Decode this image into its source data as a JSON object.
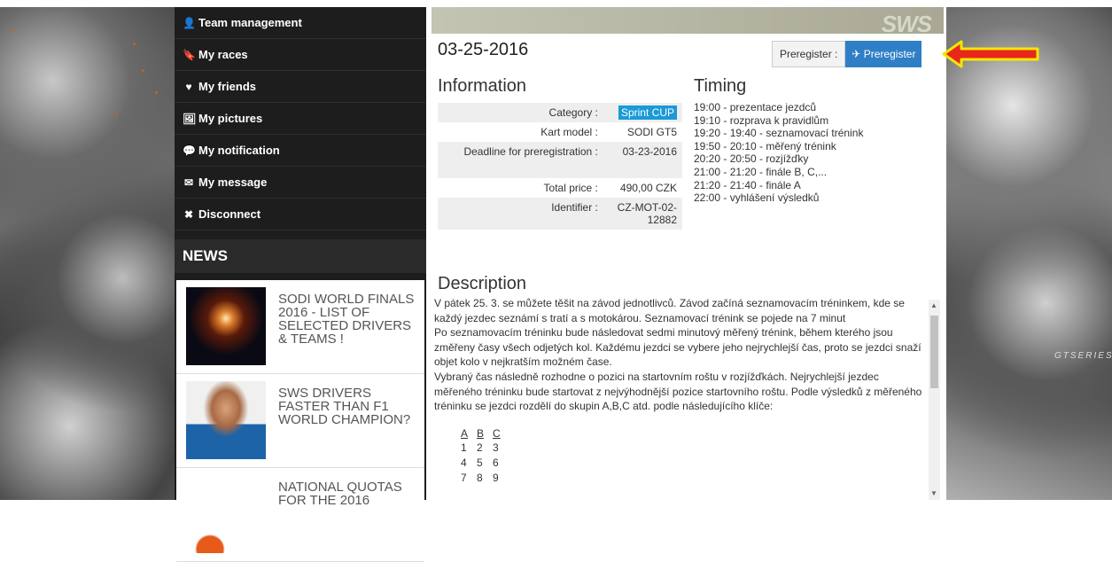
{
  "menu": [
    {
      "icon": "user-icon",
      "glyph": "👤",
      "label": "Team management"
    },
    {
      "icon": "bookmark-icon",
      "glyph": "🔖",
      "label": "My races"
    },
    {
      "icon": "heart-icon",
      "glyph": "♥",
      "label": "My friends"
    },
    {
      "icon": "picture-icon",
      "glyph": "🖼",
      "label": "My pictures"
    },
    {
      "icon": "comment-icon",
      "glyph": "💬",
      "label": "My notification"
    },
    {
      "icon": "envelope-icon",
      "glyph": "✉",
      "label": "My message"
    },
    {
      "icon": "close-icon",
      "glyph": "✖",
      "label": "Disconnect"
    }
  ],
  "news": {
    "title": "NEWS",
    "items": [
      {
        "title": "SODI WORLD FINALS 2016 - LIST OF SELECTED DRIVERS & TEAMS !"
      },
      {
        "title": "SWS DRIVERS FASTER THAN F1 WORLD CHAMPION?"
      },
      {
        "title": "NATIONAL QUOTAS FOR THE 2016"
      }
    ]
  },
  "race": {
    "date": "03-25-2016",
    "prereg_label": "Preregister :",
    "prereg_button": "Preregister",
    "info_title": "Information",
    "timing_title": "Timing",
    "info": [
      {
        "key": "Category :",
        "value": "Sprint CUP"
      },
      {
        "key": "Kart model :",
        "value": "SODI GT5"
      },
      {
        "key": "Deadline for preregistration :",
        "value": "03-23-2016"
      },
      {
        "key": "Total price :",
        "value": "490,00 CZK"
      },
      {
        "key": "Identifier :",
        "value": "CZ-MOT-02-12882"
      }
    ],
    "timing": [
      "19:00 - prezentace jezdců",
      "19:10 - rozprava k pravidlům",
      "19:20 - 19:40 - seznamovací trénink",
      "19:50 - 20:10 - měřený trénink",
      "20:20 - 20:50 - rozjížďky",
      "21:00 - 21:20 - finále B, C,...",
      "21:20 - 21:40 - finále A",
      "22:00 - vyhlášení výsledků"
    ],
    "description_title": "Description",
    "description": [
      "V pátek  25. 3. se můžete těšit na závod jednotlivců. Závod začíná seznamovacím tréninkem, kde se každý jezdec seznámí s tratí a s motokárou. Seznamovací trénink se pojede na 7 minut",
      "Po seznamovacím tréninku bude následovat sedmi minutový měřený trénink, během kterého jsou změřeny časy všech odjetých kol. Každému jezdci se vybere jeho nejrychlejší čas, proto se jezdci snaží objet kolo v nejkratším možném čase.",
      "Vybraný čas následně rozhodne o pozici na startovním roštu v rozjížďkách. Nejrychlejší jezdec měřeného tréninku bude startovat z nejvýhodnější pozice startovního roštu. Podle výsledků z měřeného tréninku se jezdci rozdělí do skupin A,B,C atd. podle následujícího klíče:"
    ],
    "groups": {
      "header": [
        "A",
        "B",
        "C"
      ],
      "rows": [
        [
          "1",
          "2",
          "3"
        ],
        [
          "4",
          "5",
          "6"
        ],
        [
          "7",
          "8",
          "9"
        ]
      ]
    }
  },
  "banner_logo": "SWS",
  "background_text": "GTSERIES",
  "colors": {
    "accent": "#2f7fc6",
    "badge": "#1a9ad6",
    "sidebar": "#1d1d1d",
    "arrow": "#e8261c",
    "arrow_outline": "#f2e600"
  }
}
